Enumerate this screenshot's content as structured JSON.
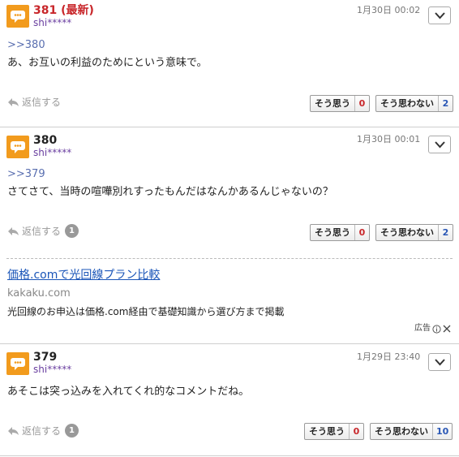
{
  "posts": [
    {
      "number": "381 (最新)",
      "user": "shi*****",
      "date": "1月30日 00:02",
      "anchor": ">>380",
      "body": "あ、お互いの利益のためにという意味で。",
      "reply_label": "返信する",
      "reply_count": "",
      "agree_label": "そう思う",
      "agree_count": "0",
      "disagree_label": "そう思わない",
      "disagree_count": "2"
    },
    {
      "number": "380",
      "user": "shi*****",
      "date": "1月30日 00:01",
      "anchor": ">>379",
      "body": "さてさて、当時の喧嘩別れすったもんだはなんかあるんじゃないの？",
      "reply_label": "返信する",
      "reply_count": "1",
      "agree_label": "そう思う",
      "agree_count": "0",
      "disagree_label": "そう思わない",
      "disagree_count": "2"
    },
    {
      "number": "379",
      "user": "shi*****",
      "date": "1月29日 23:40",
      "anchor": "",
      "body": "あそこは突っ込みを入れてくれ的なコメントだね。",
      "reply_label": "返信する",
      "reply_count": "1",
      "agree_label": "そう思う",
      "agree_count": "0",
      "disagree_label": "そう思わない",
      "disagree_count": "10"
    }
  ],
  "ad": {
    "title": "価格.comで光回線プラン比較",
    "domain": "kakaku.com",
    "description": "光回線のお申込は価格.com経由で基礎知識から選び方まで掲載",
    "label": "広告"
  },
  "colors": {
    "avatar": "#f29b1d",
    "latest_number": "#c8262a",
    "user": "#6a3fa0",
    "agree_count": "#c8262a",
    "disagree_count": "#2a57b5",
    "ad_link": "#1a55b8"
  },
  "icons": {
    "avatar": "speech-bubble-avatar-icon",
    "menu": "chevron-down-icon",
    "reply": "reply-arrow-icon",
    "ad_info": "info-icon",
    "ad_close": "close-icon"
  }
}
